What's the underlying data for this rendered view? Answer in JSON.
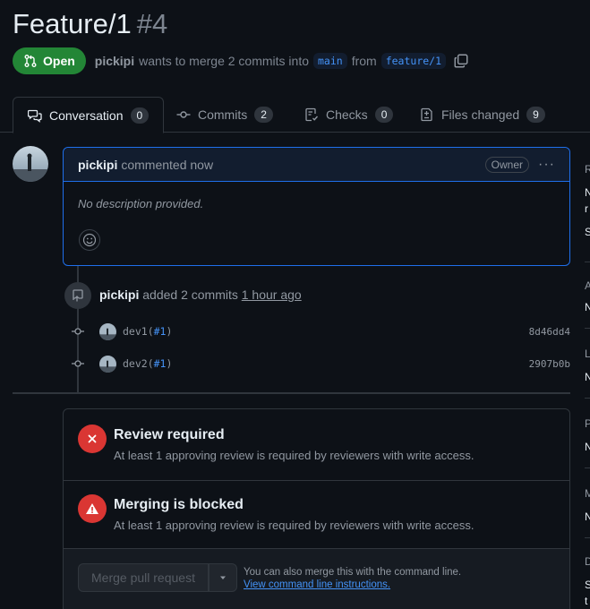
{
  "pr": {
    "title": "Feature/1",
    "number": "#4",
    "state": "Open",
    "author": "pickipi",
    "summary_mid": "wants to merge 2 commits into",
    "base_branch": "main",
    "summary_from": "from",
    "head_branch": "feature/1"
  },
  "tabs": [
    {
      "label": "Conversation",
      "count": "0",
      "icon": "comment-discussion-icon"
    },
    {
      "label": "Commits",
      "count": "2",
      "icon": "git-commit-icon"
    },
    {
      "label": "Checks",
      "count": "0",
      "icon": "checklist-icon"
    },
    {
      "label": "Files changed",
      "count": "9",
      "icon": "file-diff-icon"
    }
  ],
  "comment": {
    "author": "pickipi",
    "time": "commented now",
    "role": "Owner",
    "body": "No description provided.",
    "menu": "···"
  },
  "commit_event": {
    "author": "pickipi",
    "text": "added 2 commits",
    "time": "1 hour ago"
  },
  "commits": [
    {
      "message": "dev1(",
      "ref": "#1",
      "close": ")",
      "sha": "8d46dd4"
    },
    {
      "message": "dev2(",
      "ref": "#1",
      "close": ")",
      "sha": "2907b0b"
    }
  ],
  "merge": {
    "review_title": "Review required",
    "review_desc": "At least 1 approving review is required by reviewers with write access.",
    "blocked_title": "Merging is blocked",
    "blocked_desc": "At least 1 approving review is required by reviewers with write access.",
    "button": "Merge pull request",
    "note": "You can also merge this with the command line.",
    "link": "View command line instructions."
  },
  "sidebar_letters": [
    {
      "text": "R",
      "top": 0
    },
    {
      "text": "N",
      "top": 0
    },
    {
      "text": "r",
      "top": 0
    },
    {
      "text": "S",
      "top": 0
    },
    {
      "text": "A",
      "top": 0
    },
    {
      "text": "N",
      "top": 0
    },
    {
      "text": "L",
      "top": 0
    },
    {
      "text": "N",
      "top": 0
    },
    {
      "text": "P",
      "top": 0
    },
    {
      "text": "N",
      "top": 0
    },
    {
      "text": "M",
      "top": 0
    },
    {
      "text": "N",
      "top": 0
    },
    {
      "text": "D",
      "top": 0
    },
    {
      "text": "S",
      "top": 0
    },
    {
      "text": "t",
      "top": 0
    }
  ],
  "colors": {
    "accent_blue": "#4493f8",
    "open_green": "#238636",
    "danger_red": "#da3633",
    "background": "#0d1117"
  }
}
